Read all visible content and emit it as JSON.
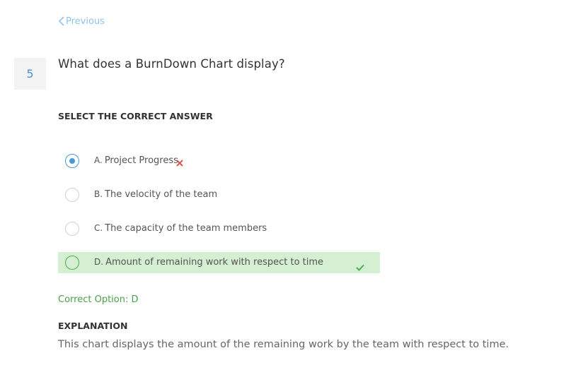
{
  "nav": {
    "previous_label": "Previous",
    "previous_icon": "chevron-left-icon",
    "link_color": "#8fc3ea"
  },
  "question": {
    "number": "5",
    "text": "What does a BurnDown Chart display?"
  },
  "instruction": "SELECT THE CORRECT ANSWER",
  "options": [
    {
      "letter": "A.",
      "text": "Project Progress",
      "selected": true,
      "status": "wrong"
    },
    {
      "letter": "B.",
      "text": "The velocity of the team",
      "selected": false,
      "status": "none"
    },
    {
      "letter": "C.",
      "text": "The capacity of the team members",
      "selected": false,
      "status": "none"
    },
    {
      "letter": "D.",
      "text": "Amount of remaining work with respect to time",
      "selected": false,
      "status": "correct"
    }
  ],
  "result": {
    "correct_option_text": "Correct Option: D"
  },
  "explanation": {
    "title": "EXPLANATION",
    "text": "This chart displays the amount of the remaining work by the team with respect to time."
  },
  "colors": {
    "accent_blue": "#4a9ad4",
    "correct_green": "#4caf50",
    "correct_bg": "#d5efd2",
    "wrong_red": "#d9534f"
  }
}
